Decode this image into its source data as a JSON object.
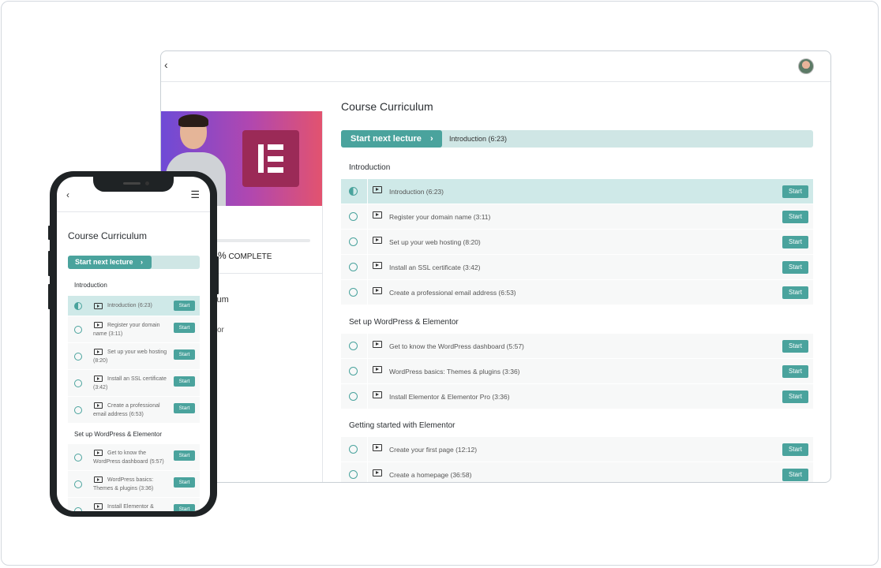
{
  "desktop": {
    "sidebar": {
      "progress_percent_suffix": "%",
      "complete_label": "COMPLETE",
      "item1": "iculum",
      "item2": "or"
    },
    "main": {
      "title": "Course Curriculum",
      "next_button_label": "Start next lecture",
      "next_button_icon": "chevron-right-icon",
      "next_lecture_info": "Introduction (6:23)",
      "sections": [
        {
          "title": "Introduction",
          "lectures": [
            {
              "title": "Introduction (6:23)",
              "state": "in-progress",
              "action": "Start"
            },
            {
              "title": "Register your domain name (3:11)",
              "state": "not-started",
              "action": "Start"
            },
            {
              "title": "Set up your web hosting (8:20)",
              "state": "not-started",
              "action": "Start"
            },
            {
              "title": "Install an SSL certificate (3:42)",
              "state": "not-started",
              "action": "Start"
            },
            {
              "title": "Create a professional email address (6:53)",
              "state": "not-started",
              "action": "Start"
            }
          ]
        },
        {
          "title": "Set up WordPress & Elementor",
          "lectures": [
            {
              "title": "Get to know the WordPress dashboard (5:57)",
              "state": "not-started",
              "action": "Start"
            },
            {
              "title": "WordPress basics: Themes & plugins (3:36)",
              "state": "not-started",
              "action": "Start"
            },
            {
              "title": "Install Elementor & Elementor Pro (3:36)",
              "state": "not-started",
              "action": "Start"
            }
          ]
        },
        {
          "title": "Getting started with Elementor",
          "lectures": [
            {
              "title": "Create your first page (12:12)",
              "state": "not-started",
              "action": "Start"
            },
            {
              "title": "Create a homepage (36:58)",
              "state": "not-started",
              "action": "Start"
            }
          ]
        }
      ]
    }
  },
  "phone": {
    "title": "Course Curriculum",
    "next_button_label": "Start next lecture",
    "sections": [
      {
        "title": "Introduction",
        "lectures": [
          {
            "title": "Introduction (6:23)",
            "state": "in-progress",
            "action": "Start"
          },
          {
            "title": "Register your domain name (3:11)",
            "state": "not-started",
            "action": "Start"
          },
          {
            "title": "Set up your web hosting (8:20)",
            "state": "not-started",
            "action": "Start"
          },
          {
            "title": "Install an SSL certificate (3:42)",
            "state": "not-started",
            "action": "Start"
          },
          {
            "title": "Create a professional email address (6:53)",
            "state": "not-started",
            "action": "Start"
          }
        ]
      },
      {
        "title": "Set up WordPress & Elementor",
        "lectures": [
          {
            "title": "Get to know the WordPress dashboard (5:57)",
            "state": "not-started",
            "action": "Start"
          },
          {
            "title": "WordPress basics: Themes & plugins (3:36)",
            "state": "not-started",
            "action": "Start"
          },
          {
            "title": "Install Elementor &",
            "state": "not-started",
            "action": "Start"
          }
        ]
      }
    ]
  },
  "colors": {
    "accent": "#4aa39d",
    "accent_light": "#cfe6e5",
    "row_bg": "#f7f8f8"
  }
}
